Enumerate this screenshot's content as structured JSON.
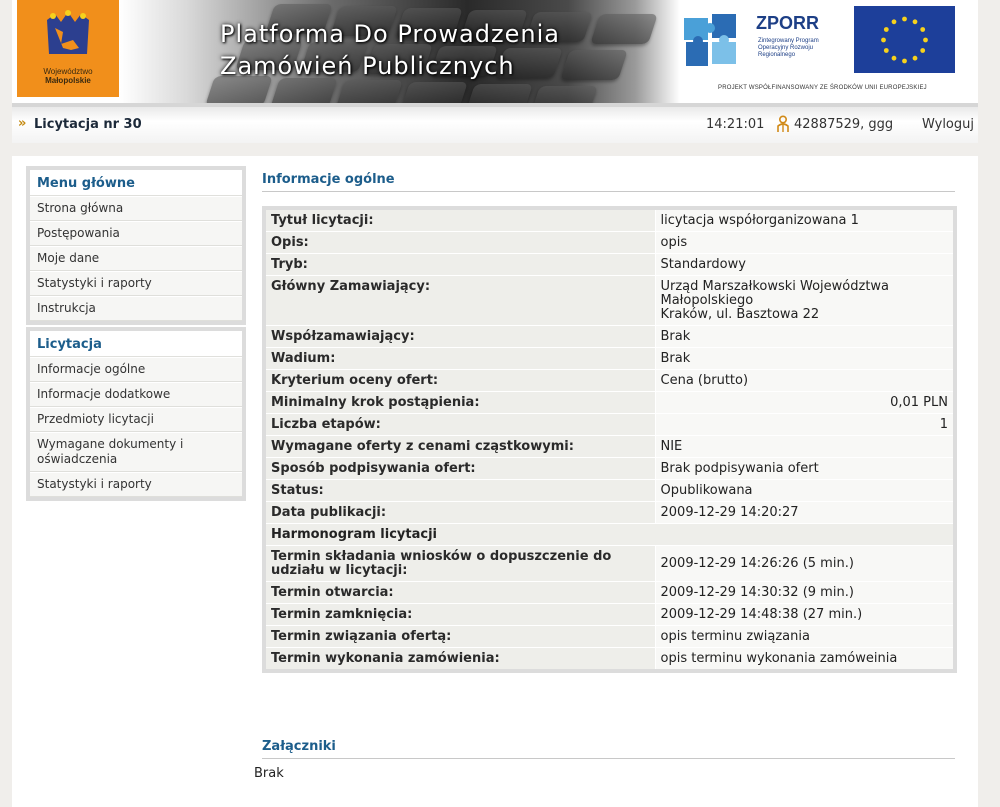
{
  "banner": {
    "logo_line1": "Województwo",
    "logo_line2": "Małopolskie",
    "title_line1": "Platforma Do Prowadzenia",
    "title_line2": "Zamówień Publicznych",
    "zporr_name": "ZPORR",
    "zporr_sub": "Zintegrowany Program Operacyjny Rozwoju Regionalnego",
    "eu_caption": "PROJEKT WSPÓŁFINANSOWANY ZE ŚRODKÓW UNII EUROPEJSKIEJ"
  },
  "toolbar": {
    "title": "Licytacja nr 30",
    "time": "14:21:01",
    "user": "42887529, ggg",
    "logout": "Wyloguj"
  },
  "sidebar": {
    "menu1": {
      "title": "Menu główne",
      "items": [
        "Strona główna",
        "Postępowania",
        "Moje dane",
        "Statystyki i raporty",
        "Instrukcja"
      ]
    },
    "menu2": {
      "title": "Licytacja",
      "items": [
        "Informacje ogólne",
        "Informacje dodatkowe",
        "Przedmioty licytacji",
        "Wymagane dokumenty i oświadczenia",
        "Statystyki i raporty"
      ]
    }
  },
  "main": {
    "section1_title": "Informacje ogólne",
    "rows": [
      {
        "k": "Tytuł licytacji:",
        "v": "licytacja współorganizowana 1"
      },
      {
        "k": "Opis:",
        "v": "opis"
      },
      {
        "k": "Tryb:",
        "v": "Standardowy"
      },
      {
        "k": "Główny Zamawiający:",
        "v": "Urząd Marszałkowski Województwa Małopolskiego",
        "v2": "Kraków, ul. Basztowa 22"
      },
      {
        "k": "Współzamawiający:",
        "v": "Brak"
      },
      {
        "k": "Wadium:",
        "v": "Brak"
      },
      {
        "k": "Kryterium oceny ofert:",
        "v": "Cena (brutto)"
      },
      {
        "k": "Minimalny krok postąpienia:",
        "v": "0,01 PLN"
      },
      {
        "k": "Liczba etapów:",
        "v": "1"
      },
      {
        "k": "Wymagane oferty z cenami cząstkowymi:",
        "v": "NIE"
      },
      {
        "k": "Sposób podpisywania ofert:",
        "v": "Brak podpisywania ofert"
      },
      {
        "k": "Status:",
        "v": "Opublikowana"
      },
      {
        "k": "Data publikacji:",
        "v": "2009-12-29 14:20:27"
      },
      {
        "k": "Harmonogram licytacji"
      },
      {
        "k": "Termin składania wniosków o dopuszczenie do udziału w licytacji:",
        "v": "2009-12-29 14:26:26 (5 min.)"
      },
      {
        "k": "Termin otwarcia:",
        "v": "2009-12-29 14:30:32 (9 min.)"
      },
      {
        "k": "Termin zamknięcia:",
        "v": "2009-12-29 14:48:38 (27 min.)"
      },
      {
        "k": "Termin związania ofertą:",
        "v": "opis terminu związania"
      },
      {
        "k": "Termin wykonania zamówienia:",
        "v": "opis terminu wykonania zamóweinia"
      }
    ],
    "section2_title": "Załączniki",
    "attachments": "Brak"
  },
  "colors": {
    "accent": "#1c5d8b",
    "logo_orange": "#f18f1b",
    "eu_blue": "#1d3f9a"
  }
}
